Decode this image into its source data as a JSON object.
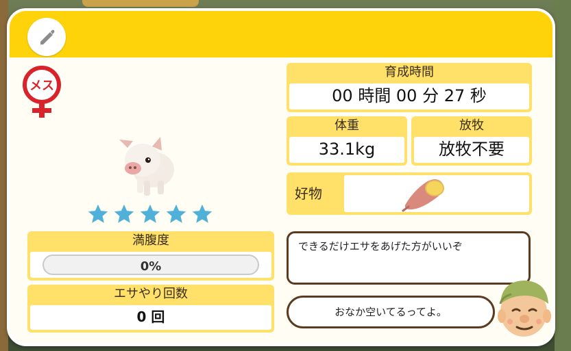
{
  "header": {
    "edit_icon": "pencil-icon"
  },
  "gender": {
    "label": "メス",
    "icon": "female-symbol-icon"
  },
  "animal": {
    "icon": "pig-icon",
    "stars": 5,
    "star_color": "#4fb0d8"
  },
  "satiety": {
    "label": "満腹度",
    "percent": 0,
    "value_text": "0%"
  },
  "feed_count": {
    "label": "エサやり回数",
    "value": "0 回"
  },
  "growth_time": {
    "label": "育成時間",
    "value": "00 時間 00 分 27 秒"
  },
  "weight": {
    "label": "体重",
    "value": "33.1kg"
  },
  "grazing": {
    "label": "放牧",
    "value": "放牧不要"
  },
  "favorite": {
    "label": "好物",
    "item_icon": "sweet-potato-icon"
  },
  "advice": {
    "bubble1": "できるだけエサをあげた方がいいぞ",
    "bubble2": "おなか空いてるってよ。",
    "speaker_icon": "farmer-face-icon"
  },
  "colors": {
    "header": "#ffd30a",
    "label_bg": "#ffe069",
    "bubble_border": "#5a3b1f"
  }
}
